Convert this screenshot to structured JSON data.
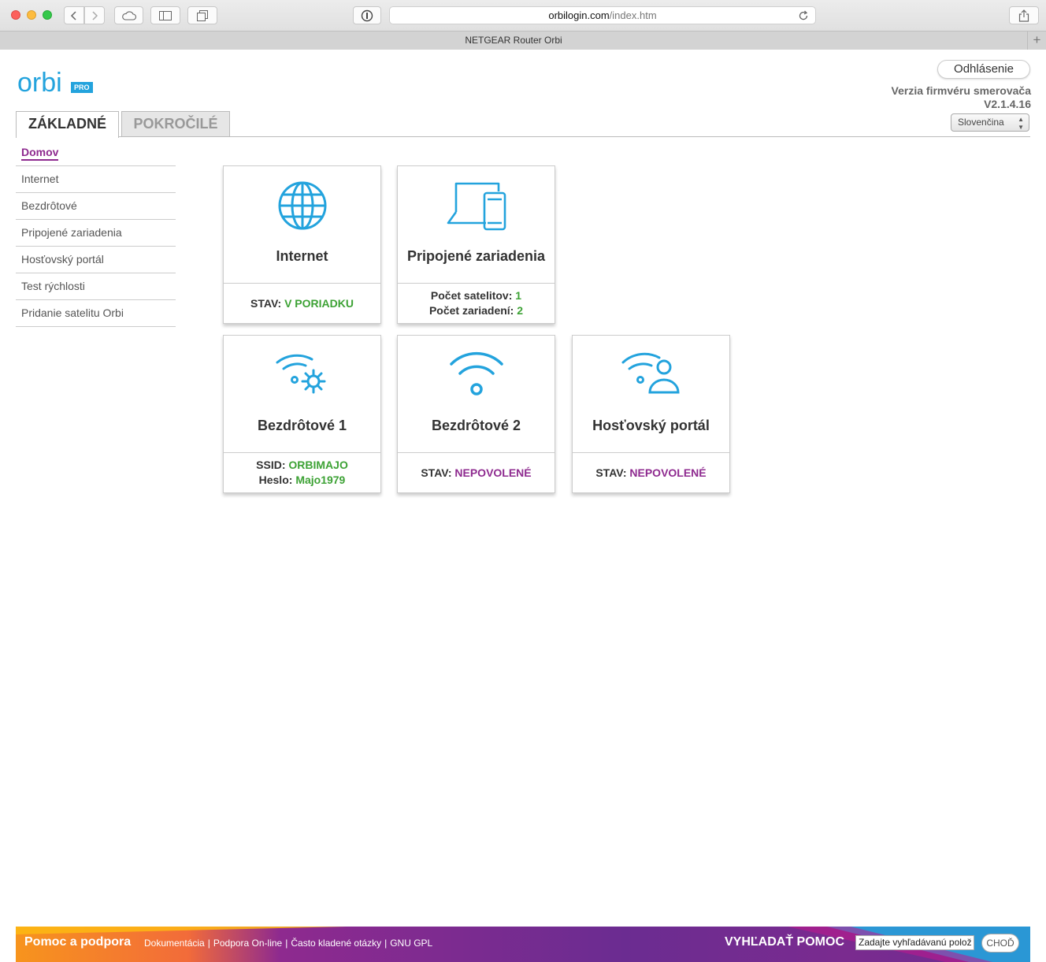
{
  "browser": {
    "url_host": "orbilogin.com",
    "url_path": "/index.htm",
    "tab_title": "NETGEAR Router Orbi",
    "new_tab": "+"
  },
  "header": {
    "logo_text": "orbi",
    "logo_badge": "PRO",
    "logout_label": "Odhlásenie",
    "firmware_label": "Verzia firmvéru smerovača",
    "firmware_version": "V2.1.4.16",
    "language": "Slovenčina"
  },
  "tabs": {
    "basic": "ZÁKLADNÉ",
    "advanced": "POKROČILÉ"
  },
  "sidebar": {
    "items": [
      {
        "label": "Domov",
        "active": true
      },
      {
        "label": "Internet"
      },
      {
        "label": "Bezdrôtové"
      },
      {
        "label": "Pripojené zariadenia"
      },
      {
        "label": "Hosťovský portál"
      },
      {
        "label": "Test rýchlosti"
      },
      {
        "label": "Pridanie satelitu Orbi"
      }
    ]
  },
  "cards": {
    "internet": {
      "title": "Internet",
      "status_label": "STAV:",
      "status_value": "V PORIADKU"
    },
    "devices": {
      "title": "Pripojené zariadenia",
      "satellites_label": "Počet satelitov:",
      "satellites_value": "1",
      "devices_label": "Počet zariadení:",
      "devices_value": "2"
    },
    "wireless1": {
      "title": "Bezdrôtové 1",
      "ssid_label": "SSID:",
      "ssid_value": "ORBIMAJO",
      "password_label": "Heslo:",
      "password_value": "Majo1979"
    },
    "wireless2": {
      "title": "Bezdrôtové 2",
      "status_label": "STAV:",
      "status_value": "NEPOVOLENÉ"
    },
    "guest": {
      "title": "Hosťovský portál",
      "status_label": "STAV:",
      "status_value": "NEPOVOLENÉ"
    }
  },
  "footer": {
    "help_title": "Pomoc a podpora",
    "links": [
      "Dokumentácia",
      "Podpora On-line",
      "Často kladené otázky",
      "GNU GPL"
    ],
    "link_separator": "|",
    "search_label": "VYHĽADAŤ POMOC",
    "search_placeholder": "Zadajte vyhľadávanú polož",
    "go_label": "CHOĎ"
  },
  "colors": {
    "accent_blue": "#23a3dd",
    "status_ok": "#3da235",
    "status_disabled": "#8e2a8f",
    "footer_orange": "#f7941d",
    "footer_purple": "#6b2c91"
  }
}
